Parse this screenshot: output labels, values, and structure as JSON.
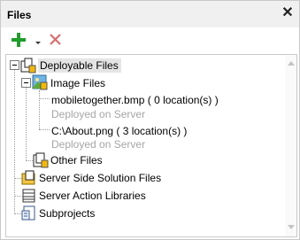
{
  "panel": {
    "title": "Files",
    "close_glyph": "✕"
  },
  "toolbar": {
    "add_icon": "add-plus-icon",
    "dropdown_icon": "chevron-down-icon",
    "delete_icon": "delete-x-icon",
    "colors": {
      "add": "#1e9e2a",
      "delete": "#e06666"
    }
  },
  "tree": {
    "deployable": {
      "label": "Deployable Files",
      "expanded": true,
      "selected": true
    },
    "image_files": {
      "label": "Image Files",
      "expanded": true
    },
    "items": [
      {
        "name": "mobiletogether.bmp  ( 0 location(s) )",
        "sub": "Deployed on Server"
      },
      {
        "name": "C:\\About.png  ( 3 location(s) )",
        "sub": "Deployed on Server"
      }
    ],
    "other_files": {
      "label": "Other Files"
    },
    "roots": [
      {
        "label": "Server Side Solution Files",
        "icon": "folder-document-icon"
      },
      {
        "label": "Server Action Libraries",
        "icon": "library-icon"
      },
      {
        "label": "Subprojects",
        "icon": "subproject-icon"
      }
    ]
  }
}
